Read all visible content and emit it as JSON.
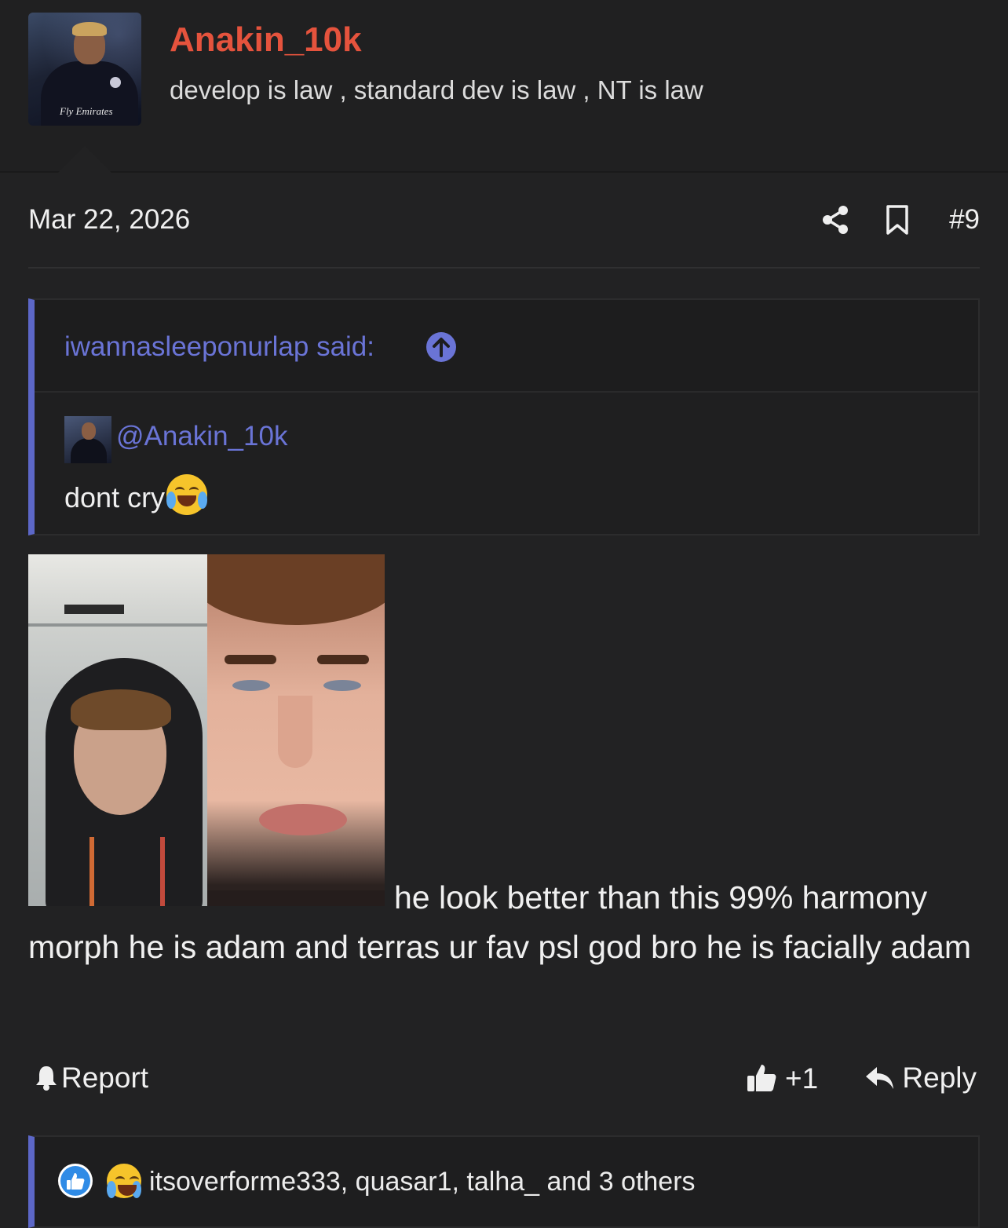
{
  "author": {
    "username": "Anakin_10k",
    "tagline": "develop is law , standard dev is law , NT is law",
    "avatar_caption": "Fly Emirates"
  },
  "post": {
    "date": "Mar 22, 2026",
    "number": "#9",
    "body": "he look better than this 99% harmony morph he is adam and terras ur fav psl god bro he is facially adam"
  },
  "quote": {
    "author_label": "iwannasleeponurlap said:",
    "mention": "@Anakin_10k",
    "text": "dont cry"
  },
  "actions": {
    "report_label": "Report",
    "like_count": "+1",
    "reply_label": "Reply"
  },
  "reactions": {
    "names": "itsoverforme333, quasar1, talha_ and 3 others"
  },
  "icons": [
    "share-icon",
    "bookmark-icon",
    "arrow-up-circle-icon",
    "bell-icon",
    "thumbs-up-icon",
    "reply-arrow-icon",
    "crying-laughing-emoji"
  ],
  "colors": {
    "background": "#222223",
    "username": "#e5533d",
    "link": "#6a74d6",
    "quote_border": "#5c67c7",
    "like_reaction": "#2f8be6"
  }
}
